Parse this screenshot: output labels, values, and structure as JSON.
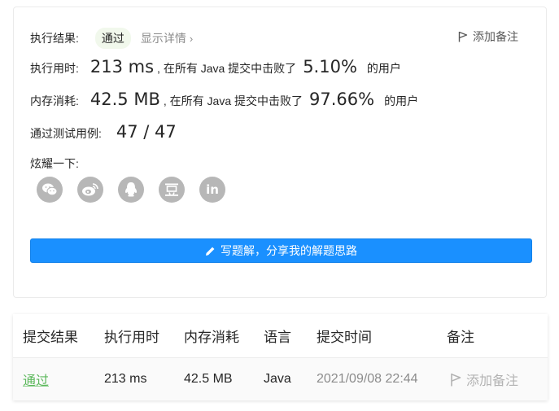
{
  "result": {
    "label": "执行结果:",
    "status": "通过",
    "details": "显示详情",
    "add_note": "添加备注"
  },
  "runtime": {
    "label": "执行用时:",
    "value": "213 ms",
    "text": ", 在所有 Java 提交中击败了",
    "percent": "5.10%",
    "suffix": "的用户"
  },
  "memory": {
    "label": "内存消耗:",
    "value": "42.5 MB",
    "text": ", 在所有 Java 提交中击败了",
    "percent": "97.66%",
    "suffix": "的用户"
  },
  "tests": {
    "label": "通过测试用例:",
    "value": "47 / 47"
  },
  "share": {
    "label": "炫耀一下:",
    "icons": [
      "wechat-icon",
      "weibo-icon",
      "qq-icon",
      "douban-icon",
      "linkedin-icon"
    ]
  },
  "write_solution_button": "写题解，分享我的解题思路",
  "table": {
    "headers": [
      "提交结果",
      "执行用时",
      "内存消耗",
      "语言",
      "提交时间",
      "备注"
    ],
    "row": {
      "result": "通过",
      "runtime": "213 ms",
      "memory": "42.5 MB",
      "language": "Java",
      "time": "2021/09/08 22:44",
      "note": "添加备注"
    }
  },
  "colors": {
    "accent": "#1a90ff",
    "success": "#5cb85c",
    "pill_bg": "#f1f8ec",
    "icon_grey": "#b7b7b7"
  }
}
